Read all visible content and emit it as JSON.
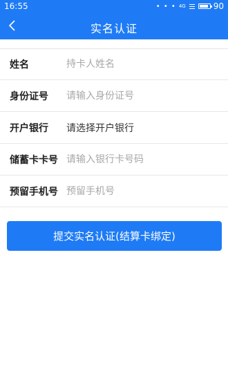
{
  "status_bar": {
    "time": "16:55",
    "signal_dots": "• • •",
    "network": "4G",
    "battery_level": "90",
    "battery_fill_fraction": 0.9
  },
  "nav": {
    "back_icon": "chevron-left-icon",
    "title": "实名认证"
  },
  "form": {
    "name": {
      "label": "姓名",
      "placeholder": "持卡人姓名",
      "value": ""
    },
    "id_number": {
      "label": "身份证号",
      "placeholder": "请输入身份证号",
      "value": ""
    },
    "bank": {
      "label": "开户银行",
      "value": "请选择开户银行"
    },
    "card_number": {
      "label": "储蓄卡卡号",
      "placeholder": "请输入银行卡号码",
      "value": ""
    },
    "phone": {
      "label": "预留手机号",
      "placeholder": "预留手机号",
      "value": ""
    }
  },
  "submit_label": "提交实名认证(结算卡绑定)",
  "colors": {
    "primary": "#1e7bf5",
    "divider": "#e6e6e6",
    "placeholder": "#a8a8a8"
  }
}
